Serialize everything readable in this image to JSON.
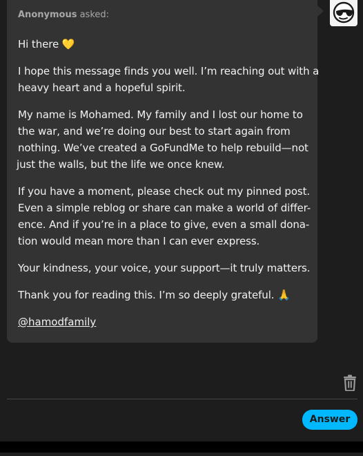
{
  "ask": {
    "asker_name": "Anonymous",
    "asker_suffix": "asked:",
    "greeting_text": "Hi there",
    "greeting_emoji": "💛",
    "paragraph1": [
      "I hope this message finds you well. I’m reaching out with a",
      "heavy heart and a hopeful spirit."
    ],
    "paragraph2": [
      "My name is Mohamed. My family and I lost our home to",
      "the war, and we’re doing our best to start again from",
      "nothing. We’ve created a GoFundMe to help rebuild—not",
      "just the walls, but the life we once knew."
    ],
    "paragraph3": [
      "If you have a moment, please check out my pinned post.",
      "Even a simple reblog or share can make a world of differ-",
      "ence. And if you’re in a place to give, even a small dona-",
      "tion would mean more than I can ever express."
    ],
    "paragraph4": "Your kindness, your voice, your support—it truly matters.",
    "paragraph5_text": "Thank you for reading this. I’m so deeply grateful.",
    "paragraph5_emoji": "🙏",
    "mention": "@hamodfamily"
  },
  "avatar": {
    "icon": "sunglasses-face-icon"
  },
  "actions": {
    "delete_icon": "trash-icon",
    "answer_label": "Answer"
  },
  "colors": {
    "page_bg": "#1d1d1d",
    "bubble_bg": "#333333",
    "text": "#f2f2f2",
    "muted": "#a8a8a8",
    "accent": "#00b8ff",
    "divider": "#474747"
  }
}
